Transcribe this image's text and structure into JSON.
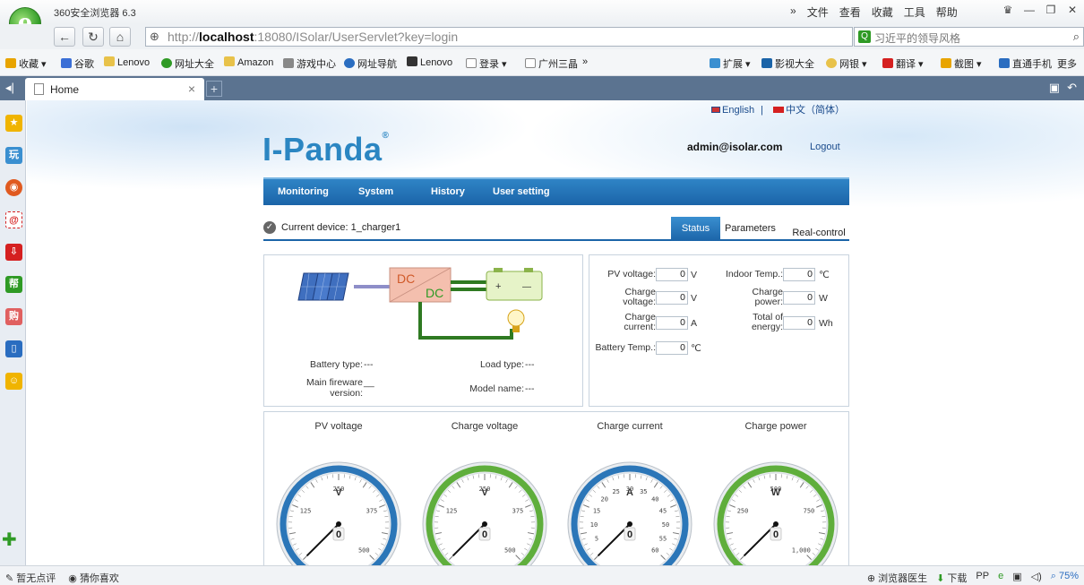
{
  "browser": {
    "app_title": "360安全浏览器 6.3",
    "title_menu": [
      "»",
      "文件",
      "查看",
      "收藏",
      "工具",
      "帮助"
    ],
    "url_host": "localhost",
    "url_prefix": "http://",
    "url_rest": ":18080/ISolar/UserServlet?key=login",
    "search_text": "习近平的领导风格",
    "favorites": [
      "收藏",
      "谷歌",
      "Lenovo",
      "网址大全",
      "Amazon",
      "游戏中心",
      "网址导航",
      "Lenovo",
      "登录",
      "广州三晶",
      "»"
    ],
    "fav_right": [
      "扩展",
      "影视大全",
      "网银",
      "翻译",
      "截图",
      "直通手机",
      "更多"
    ],
    "tab_title": "Home",
    "tab_close": "×",
    "tab_new": "+",
    "status_left": [
      "暂无点评",
      "猜你喜欢"
    ],
    "status_right": [
      "浏览器医生",
      "下载",
      "75%"
    ]
  },
  "page": {
    "lang_english": "English",
    "lang_sep": "|",
    "lang_chinese": "中文（简体）",
    "brand": "I-Panda",
    "brand_mark": "®",
    "user_email": "admin@isolar.com",
    "logout": "Logout",
    "nav": [
      "Monitoring",
      "System",
      "History",
      "User setting"
    ],
    "current_device": "Current device: 1_charger1",
    "tabs": {
      "status": "Status",
      "parameters": "Parameters",
      "real_control": "Real-control"
    },
    "diagram": {
      "dc1": "DC",
      "dc2": "DC",
      "plus": "+",
      "minus": "—"
    },
    "info": {
      "battery_type_label": "Battery type:",
      "battery_type_value": "---",
      "load_type_label": "Load type:",
      "load_type_value": "---",
      "firmware_label_1": "Main fireware",
      "firmware_label_2": "version:",
      "firmware_value": "__",
      "model_name_label": "Model name:",
      "model_name_value": "---"
    },
    "fields": {
      "pv_voltage": {
        "label": "PV voltage:",
        "value": "0",
        "unit": "V"
      },
      "charge_voltage": {
        "label1": "Charge",
        "label2": "voltage:",
        "value": "0",
        "unit": "V"
      },
      "charge_current": {
        "label1": "Charge",
        "label2": "current:",
        "value": "0",
        "unit": "A"
      },
      "battery_temp": {
        "label": "Battery Temp.:",
        "value": "0",
        "unit": "℃"
      },
      "indoor_temp": {
        "label": "Indoor Temp.:",
        "value": "0",
        "unit": "℃"
      },
      "charge_power": {
        "label1": "Charge",
        "label2": "power:",
        "value": "0",
        "unit": "W"
      },
      "total_energy": {
        "label1": "Total of",
        "label2": "energy:",
        "value": "0",
        "unit": "Wh"
      }
    },
    "gauges": [
      {
        "title": "PV voltage",
        "unit": "V",
        "value": "0",
        "ticks": [
          "125",
          "250",
          "375",
          "500"
        ],
        "accent": "#2b76b8"
      },
      {
        "title": "Charge voltage",
        "unit": "V",
        "value": "0",
        "ticks": [
          "125",
          "250",
          "375",
          "500"
        ],
        "accent": "#5fae3c"
      },
      {
        "title": "Charge current",
        "unit": "A",
        "value": "0",
        "ticks": [
          "5",
          "10",
          "15",
          "20",
          "25",
          "30",
          "35",
          "40",
          "45",
          "50",
          "55",
          "60"
        ],
        "accent": "#2b76b8"
      },
      {
        "title": "Charge power",
        "unit": "W",
        "value": "0",
        "ticks": [
          "250",
          "500",
          "750",
          "1,000"
        ],
        "accent": "#5fae3c"
      }
    ]
  }
}
